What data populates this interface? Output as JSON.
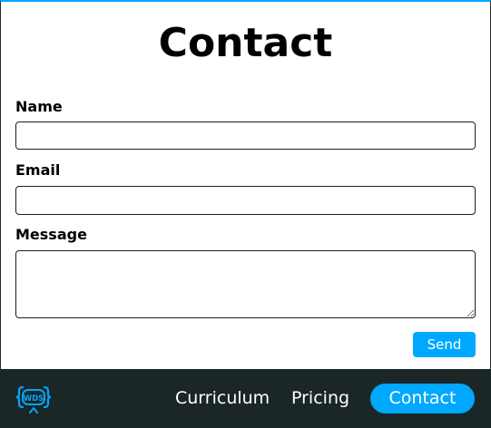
{
  "page": {
    "title": "Contact"
  },
  "form": {
    "name_label": "Name",
    "name_value": "",
    "email_label": "Email",
    "email_value": "",
    "message_label": "Message",
    "message_value": "",
    "send_label": "Send"
  },
  "footer": {
    "logo_text": "WDS",
    "logo_icon": "wds-logo-icon",
    "nav": {
      "curriculum": "Curriculum",
      "pricing": "Pricing",
      "contact": "Contact"
    }
  },
  "colors": {
    "accent": "#00a8ff",
    "footer_bg": "#1a2726",
    "text": "#000000"
  }
}
